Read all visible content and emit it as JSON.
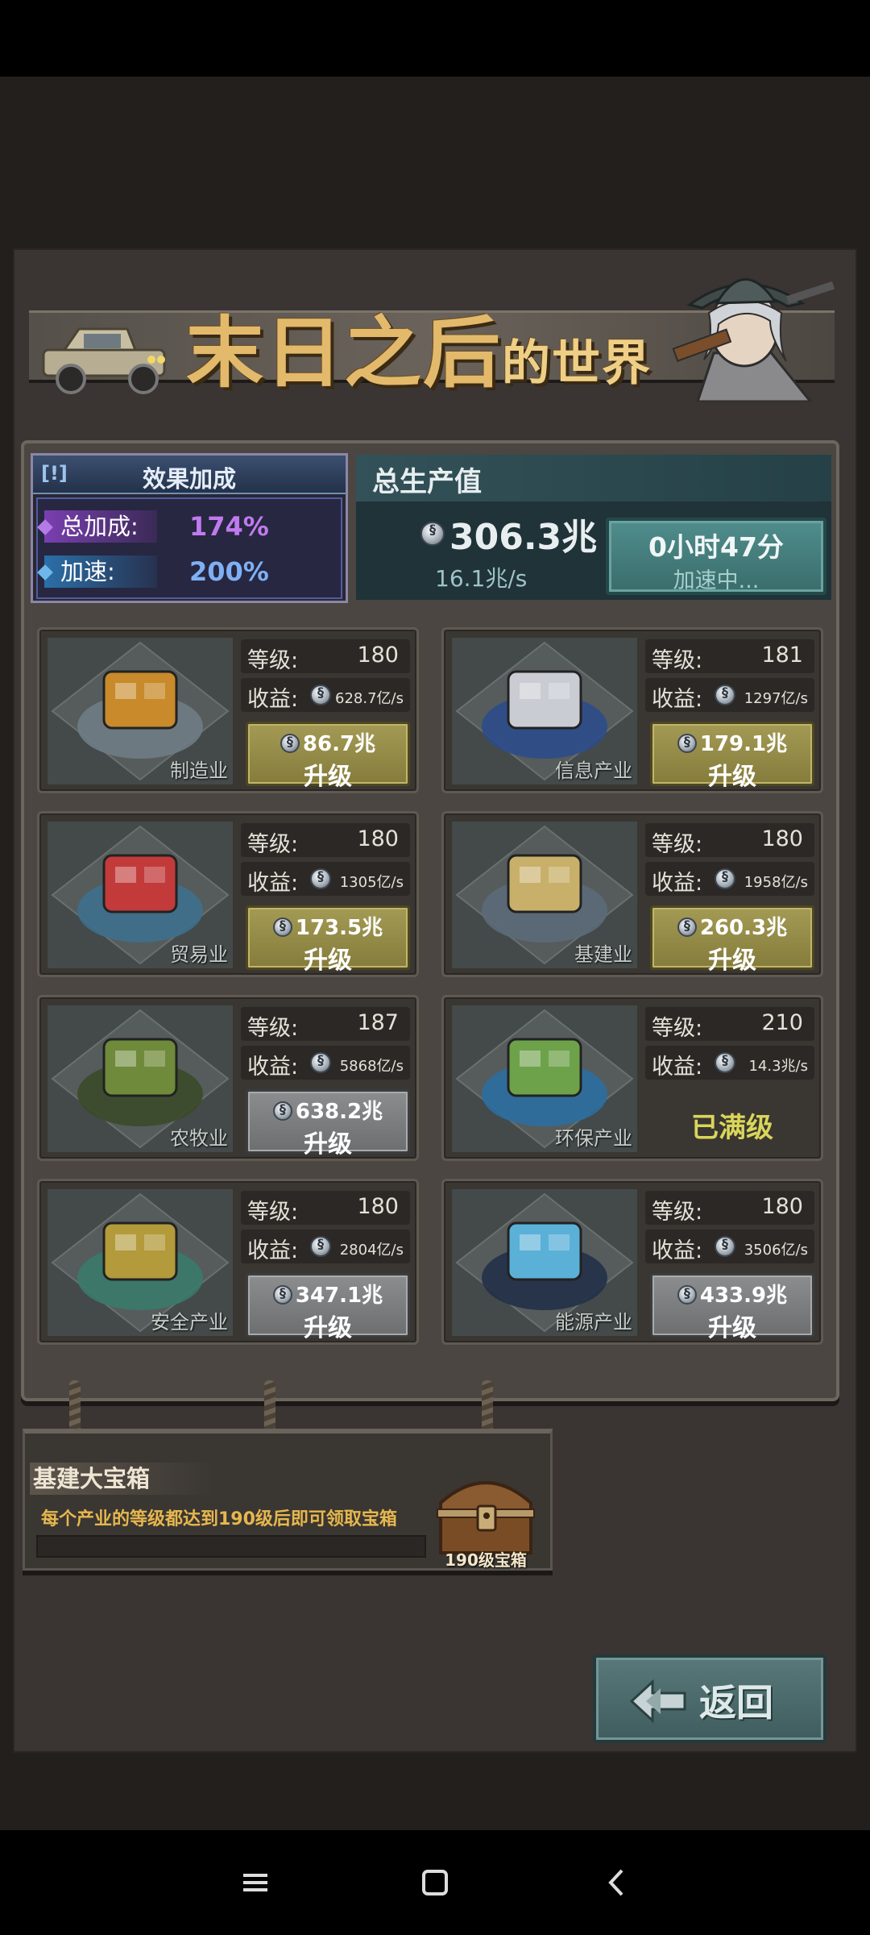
{
  "game": {
    "title_main": "末日之后",
    "title_suffix": "的世界"
  },
  "effect": {
    "icon": "[!]",
    "title": "效果加成",
    "total_label": "总加成:",
    "total_value": "174%",
    "speed_label": "加速:",
    "speed_value": "200%"
  },
  "production": {
    "title": "总生产值",
    "value": "306.3兆",
    "rate": "16.1兆/s",
    "speed_time": "0小时47分",
    "speed_status": "加速中..."
  },
  "labels": {
    "level": "等级:",
    "income": "收益:",
    "upgrade": "升级",
    "maxed": "已满级"
  },
  "industries": [
    {
      "name": "制造业",
      "level": "180",
      "income": "628.7亿/s",
      "cost": "86.7兆",
      "button": "gold",
      "icon": "robot-arm-icon"
    },
    {
      "name": "信息产业",
      "level": "181",
      "income": "1297亿/s",
      "cost": "179.1兆",
      "button": "gold",
      "icon": "satellite-icon"
    },
    {
      "name": "贸易业",
      "level": "180",
      "income": "1305亿/s",
      "cost": "173.5兆",
      "button": "gold",
      "icon": "cargo-ship-icon"
    },
    {
      "name": "基建业",
      "level": "180",
      "income": "1958亿/s",
      "cost": "260.3兆",
      "button": "gold",
      "icon": "city-icon"
    },
    {
      "name": "农牧业",
      "level": "187",
      "income": "5868亿/s",
      "cost": "638.2兆",
      "button": "gray",
      "icon": "harvester-icon"
    },
    {
      "name": "环保产业",
      "level": "210",
      "income": "14.3兆/s",
      "cost": "",
      "button": "maxed",
      "icon": "tree-globe-icon"
    },
    {
      "name": "安全产业",
      "level": "180",
      "income": "2804亿/s",
      "cost": "347.1兆",
      "button": "gray",
      "icon": "gas-mask-icon"
    },
    {
      "name": "能源产业",
      "level": "180",
      "income": "3506亿/s",
      "cost": "433.9兆",
      "button": "gray",
      "icon": "energy-core-icon"
    }
  ],
  "chest": {
    "title": "基建大宝箱",
    "desc": "每个产业的等级都达到190级后即可领取宝箱",
    "label": "190级宝箱",
    "progress": 0
  },
  "back": {
    "label": "返回"
  },
  "colors": {
    "total_bonus": "#c07af0",
    "speed_bonus": "#7fb0f4",
    "maxed": "#d9d65a"
  }
}
